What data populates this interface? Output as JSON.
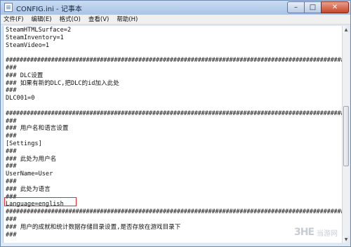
{
  "window": {
    "title": "CONFIG.ini - 记事本",
    "controls": {
      "minimize": "–",
      "maximize": "□",
      "close": "✕"
    }
  },
  "menu": {
    "items": [
      "文件(F)",
      "编辑(E)",
      "格式(O)",
      "查看(V)",
      "帮助(H)"
    ]
  },
  "editor": {
    "lines": [
      "SteamHTMLSurface=2",
      "SteamInventory=1",
      "SteamVideo=1",
      "",
      "########################################################################################################",
      "###",
      "### DLC设置",
      "### 如果有新的DLC,把DLC的id加入此处",
      "###",
      "DLC001=0",
      "",
      "########################################################################################################",
      "###",
      "### 用户名和语言设置",
      "###",
      "[Settings]",
      "###",
      "### 此处为用户名",
      "###",
      "UserName=User",
      "###",
      "### 此处为语言",
      "###",
      "Language=english",
      "########################################################################################################",
      "###",
      "### 用户的成就和统计数据存储目录设置,是否存放在游戏目录下",
      "###"
    ]
  },
  "watermark": {
    "logo": "3HE",
    "text": "当游网"
  },
  "colors": {
    "highlight_box": "#e03030",
    "title_bar": "#b9cfea"
  }
}
